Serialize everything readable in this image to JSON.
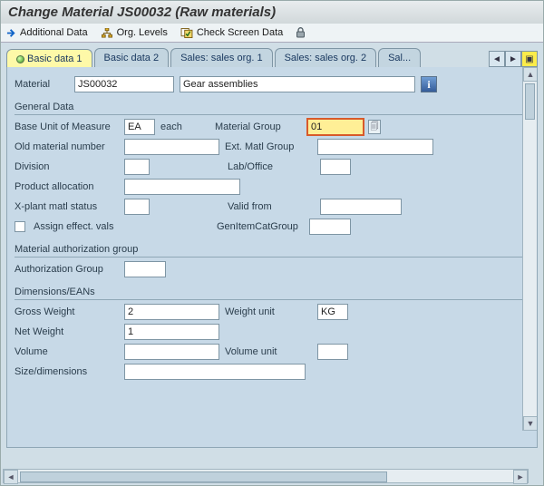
{
  "title": "Change Material JS00032 (Raw materials)",
  "toolbar": {
    "additional_data": "Additional Data",
    "org_levels": "Org. Levels",
    "check_screen": "Check Screen Data"
  },
  "tabs": {
    "t1": "Basic data 1",
    "t2": "Basic data 2",
    "t3": "Sales: sales org. 1",
    "t4": "Sales: sales org. 2",
    "t5": "Sal..."
  },
  "material": {
    "label": "Material",
    "number": "JS00032",
    "desc": "Gear assemblies"
  },
  "general": {
    "title": "General Data",
    "buom_lbl": "Base Unit of Measure",
    "buom_val": "EA",
    "buom_txt": "each",
    "matgrp_lbl": "Material Group",
    "matgrp_val": "01",
    "oldmat_lbl": "Old material number",
    "extmatgrp_lbl": "Ext. Matl Group",
    "division_lbl": "Division",
    "lab_lbl": "Lab/Office",
    "prodalloc_lbl": "Product allocation",
    "xplant_lbl": "X-plant matl status",
    "validfrom_lbl": "Valid from",
    "assign_lbl": "Assign effect. vals",
    "genitem_lbl": "GenItemCatGroup"
  },
  "auth": {
    "title": "Material authorization group",
    "lbl": "Authorization Group"
  },
  "dim": {
    "title": "Dimensions/EANs",
    "gross_lbl": "Gross Weight",
    "gross_val": "2",
    "wunit_lbl": "Weight unit",
    "wunit_val": "KG",
    "net_lbl": "Net Weight",
    "net_val": "1",
    "vol_lbl": "Volume",
    "vunit_lbl": "Volume unit",
    "size_lbl": "Size/dimensions"
  }
}
